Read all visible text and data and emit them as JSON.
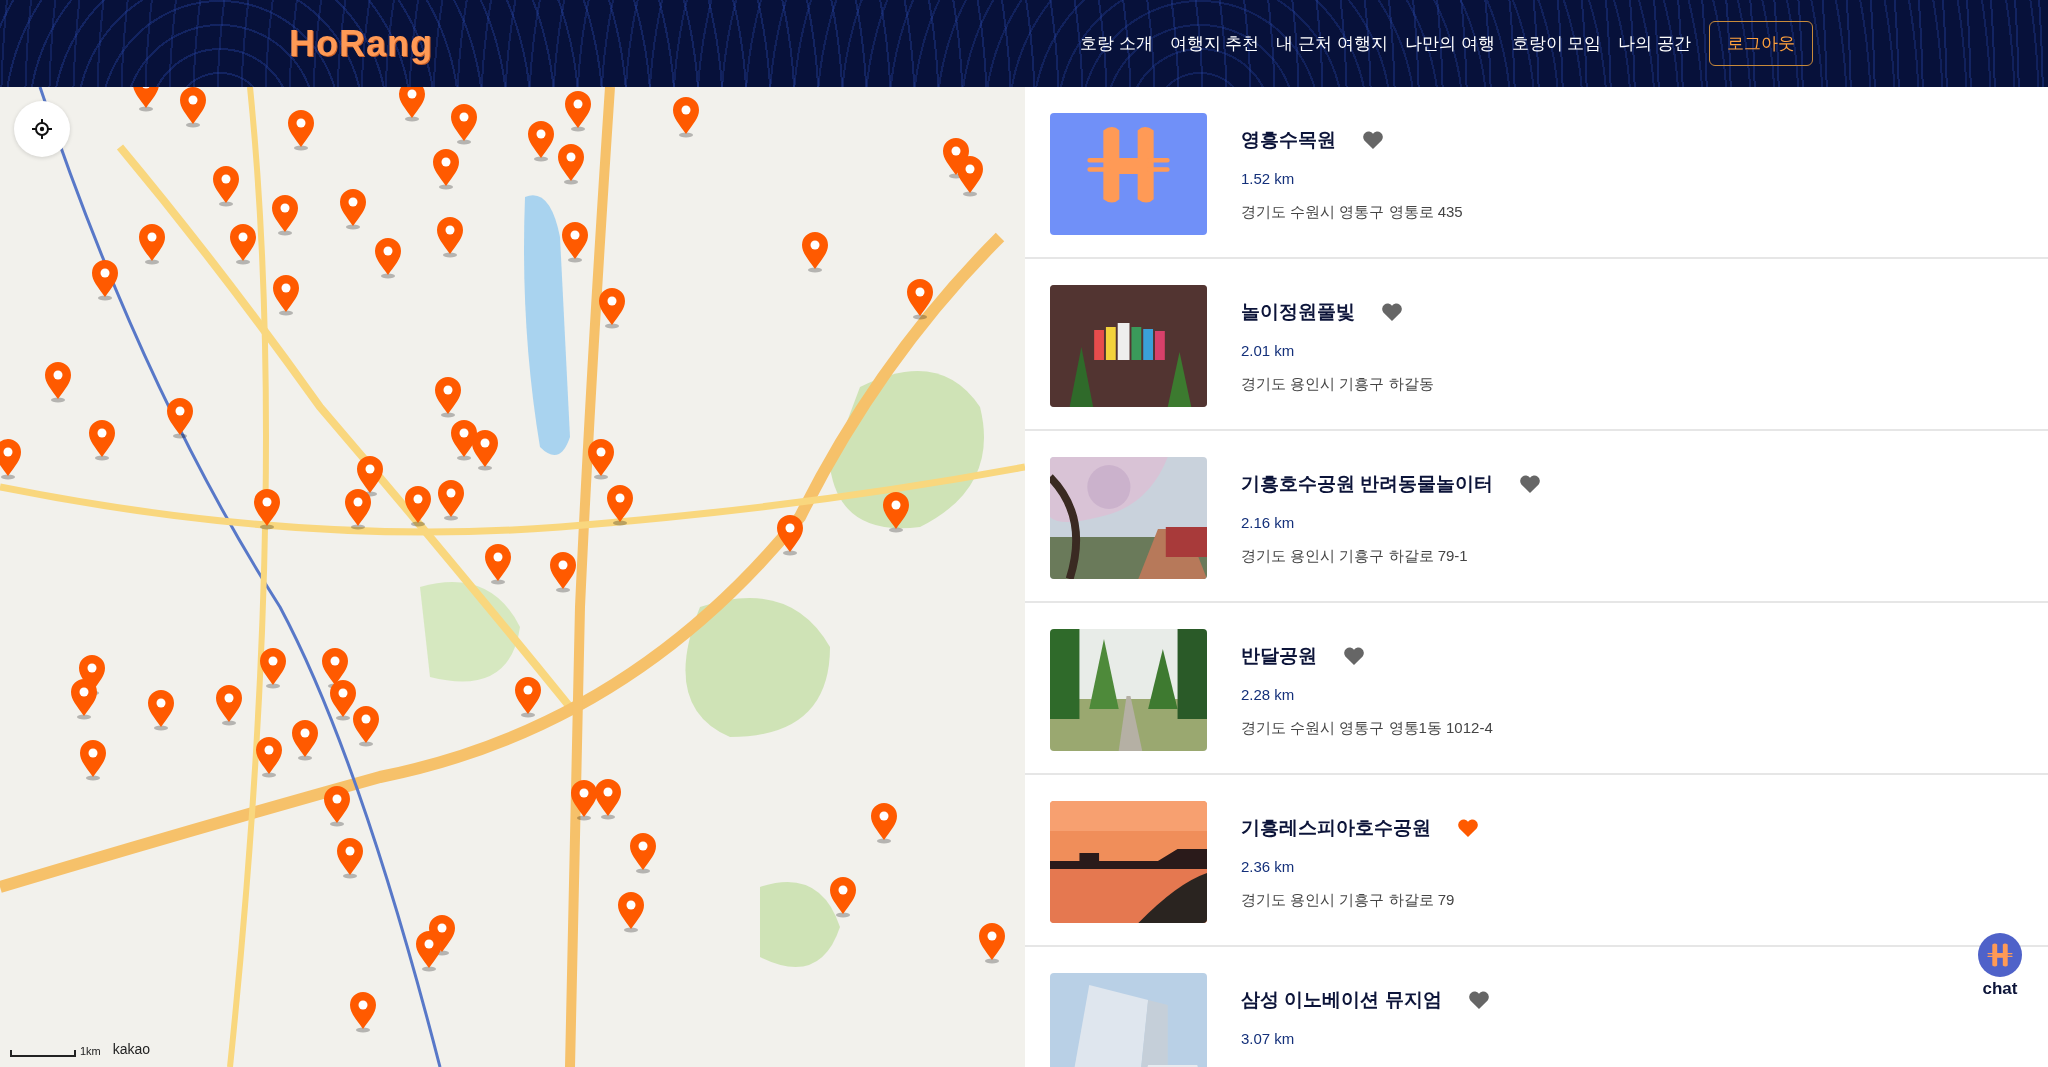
{
  "header": {
    "logo": "HoRang",
    "nav": [
      "호랑 소개",
      "여행지 추천",
      "내 근처 여행지",
      "나만의 여행",
      "호랑이 모임",
      "나의 공간"
    ],
    "logout": "로그아웃"
  },
  "map": {
    "scale": "1km",
    "attribution": "kakao"
  },
  "places": [
    {
      "name": "영흥수목원",
      "favorite": false,
      "distance": "1.52 km",
      "address": "경기도 수원시 영통구 영통로 435",
      "image": {
        "kind": "logo"
      }
    },
    {
      "name": "놀이정원풀빛",
      "favorite": false,
      "distance": "2.01 km",
      "address": "경기도 용인시 기흥구 하갈동"
    },
    {
      "name": "기흥호수공원 반려동물놀이터",
      "favorite": false,
      "distance": "2.16 km",
      "address": "경기도 용인시 기흥구 하갈로 79-1"
    },
    {
      "name": "반달공원",
      "favorite": false,
      "distance": "2.28 km",
      "address": "경기도 수원시 영통구 영통1동 1012-4"
    },
    {
      "name": "기흥레스피아호수공원",
      "favorite": true,
      "distance": "2.36 km",
      "address": "경기도 용인시 기흥구 하갈로 79"
    },
    {
      "name": "삼성 이노베이션 뮤지엄",
      "favorite": false,
      "distance": "3.07 km"
    }
  ],
  "chat": {
    "label": "chat"
  }
}
